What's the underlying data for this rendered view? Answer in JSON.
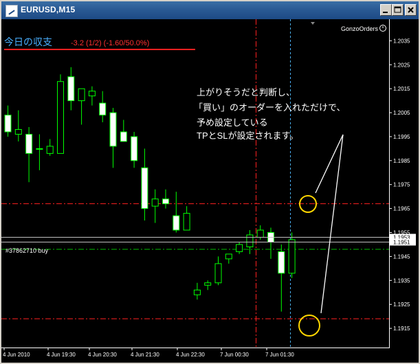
{
  "window": {
    "title": "EURUSD,M15",
    "minimize_icon": "minimize-icon",
    "maximize_icon": "maximize-icon",
    "close_icon": "close-icon"
  },
  "chart": {
    "indicator_name": "GonzoOrders",
    "indicator_icon": "circle-settings-icon",
    "pnl_label": "今日の収支",
    "pnl_value": "-3.2 (1/2) (-1.60/50.0%)",
    "order_label": "#37862710 buy",
    "annotation_lines": [
      "上がりそうだと判断し、",
      "「買い」のオーダーを入れただけで、",
      "予め設定している",
      "TPとSLが設定されます。"
    ],
    "current_prices": [
      "1.1953",
      "1.1951"
    ],
    "colors": {
      "background": "#000000",
      "bullish_body": "#000000",
      "bearish_body": "#ffffff",
      "candle_outline": "#00ff00",
      "pnl_label": "#4ab0ff",
      "pnl_value": "#ff3030",
      "tp_sl_lines": "#ff2020",
      "entry_line": "#00c000",
      "highlight_circle": "#ffd700"
    }
  },
  "chart_data": {
    "type": "candlestick",
    "symbol": "EURUSD",
    "timeframe": "M15",
    "y_ticks": [
      "1.2035",
      "1.2025",
      "1.2015",
      "1.2005",
      "1.1995",
      "1.1985",
      "1.1975",
      "1.1965",
      "1.1955",
      "1.1945",
      "1.1935",
      "1.1925",
      "1.1915"
    ],
    "x_ticks": [
      "4 Jun 2010",
      "4 Jun 19:30",
      "4 Jun 20:30",
      "4 Jun 21:30",
      "4 Jun 22:30",
      "7 Jun 00:30",
      "7 Jun 01:30"
    ],
    "ylim": [
      1.1907,
      1.2044
    ],
    "candles": [
      {
        "o": 1.2004,
        "h": 1.2008,
        "l": 1.1995,
        "c": 1.1997
      },
      {
        "o": 1.1996,
        "h": 1.2006,
        "l": 1.1993,
        "c": 1.1998
      },
      {
        "o": 1.1996,
        "h": 1.1999,
        "l": 1.1976,
        "c": 1.1988
      },
      {
        "o": 1.199,
        "h": 1.1996,
        "l": 1.1981,
        "c": 1.199
      },
      {
        "o": 1.1988,
        "h": 1.1994,
        "l": 1.1987,
        "c": 1.1991
      },
      {
        "o": 1.1988,
        "h": 1.2021,
        "l": 1.1988,
        "c": 1.2018
      },
      {
        "o": 1.202,
        "h": 1.2024,
        "l": 1.2006,
        "c": 1.201
      },
      {
        "o": 1.201,
        "h": 1.2015,
        "l": 1.2,
        "c": 1.2015
      },
      {
        "o": 1.2012,
        "h": 1.2016,
        "l": 1.2008,
        "c": 1.2014
      },
      {
        "o": 1.2009,
        "h": 1.2014,
        "l": 1.2001,
        "c": 1.2004
      },
      {
        "o": 1.2005,
        "h": 1.2007,
        "l": 1.1982,
        "c": 1.1991
      },
      {
        "o": 1.1997,
        "h": 1.2002,
        "l": 1.1994,
        "c": 1.1993
      },
      {
        "o": 1.1995,
        "h": 1.1997,
        "l": 1.1982,
        "c": 1.1985
      },
      {
        "o": 1.1982,
        "h": 1.199,
        "l": 1.196,
        "c": 1.1965
      },
      {
        "o": 1.1966,
        "h": 1.1973,
        "l": 1.1959,
        "c": 1.1969
      },
      {
        "o": 1.1969,
        "h": 1.1973,
        "l": 1.1965,
        "c": 1.1967
      },
      {
        "o": 1.1962,
        "h": 1.1972,
        "l": 1.1955,
        "c": 1.1956
      },
      {
        "o": 1.1956,
        "h": 1.1966,
        "l": 1.1956,
        "c": 1.1963
      },
      {
        "o": 1.1929,
        "h": 1.1934,
        "l": 1.1927,
        "c": 1.1931
      },
      {
        "o": 1.1933,
        "h": 1.1935,
        "l": 1.1931,
        "c": 1.1934
      },
      {
        "o": 1.1934,
        "h": 1.1945,
        "l": 1.1933,
        "c": 1.1942
      },
      {
        "o": 1.1944,
        "h": 1.1946,
        "l": 1.1942,
        "c": 1.1946
      },
      {
        "o": 1.1947,
        "h": 1.1951,
        "l": 1.1946,
        "c": 1.195
      },
      {
        "o": 1.1949,
        "h": 1.1956,
        "l": 1.1946,
        "c": 1.1954
      },
      {
        "o": 1.1953,
        "h": 1.1958,
        "l": 1.1952,
        "c": 1.1956
      },
      {
        "o": 1.1955,
        "h": 1.1957,
        "l": 1.1944,
        "c": 1.1951
      },
      {
        "o": 1.1947,
        "h": 1.195,
        "l": 1.1922,
        "c": 1.1938
      },
      {
        "o": 1.1938,
        "h": 1.1955,
        "l": 1.1936,
        "c": 1.1952
      }
    ],
    "levels": {
      "take_profit": 1.1967,
      "entry": 1.1948,
      "stop_loss": 1.1919,
      "bid": 1.1951,
      "ask": 1.1953
    }
  }
}
